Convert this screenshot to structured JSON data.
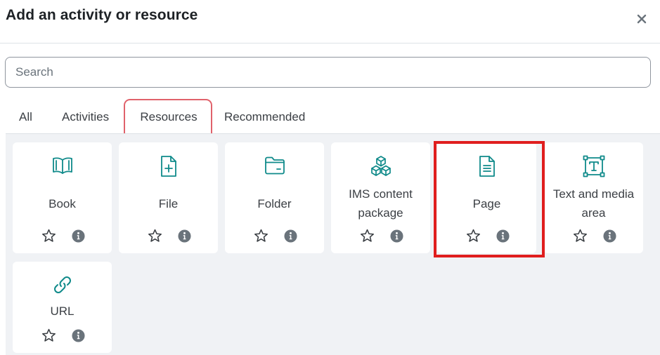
{
  "modal": {
    "title": "Add an activity or resource",
    "close_icon": "close-icon"
  },
  "search": {
    "placeholder": "Search",
    "value": ""
  },
  "tabs": [
    {
      "label": "All",
      "active": false
    },
    {
      "label": "Activities",
      "active": false
    },
    {
      "label": "Resources",
      "active": true
    },
    {
      "label": "Recommended",
      "active": false
    }
  ],
  "colors": {
    "accent": "#0f8a8a",
    "tab_highlight": "#e0626b",
    "item_highlight": "#e01e1e",
    "panel_bg": "#f0f2f5",
    "info_icon": "#6a737b"
  },
  "items": [
    {
      "name": "Book",
      "icon": "book-icon"
    },
    {
      "name": "File",
      "icon": "file-plus-icon"
    },
    {
      "name": "Folder",
      "icon": "folder-icon"
    },
    {
      "name": "IMS content package",
      "icon": "cubes-icon"
    },
    {
      "name": "Page",
      "icon": "page-icon"
    },
    {
      "name": "Text and media area",
      "icon": "text-frame-icon"
    },
    {
      "name": "URL",
      "icon": "link-icon"
    }
  ],
  "item_actions": {
    "star_icon": "star-outline-icon",
    "info_icon": "info-icon"
  }
}
